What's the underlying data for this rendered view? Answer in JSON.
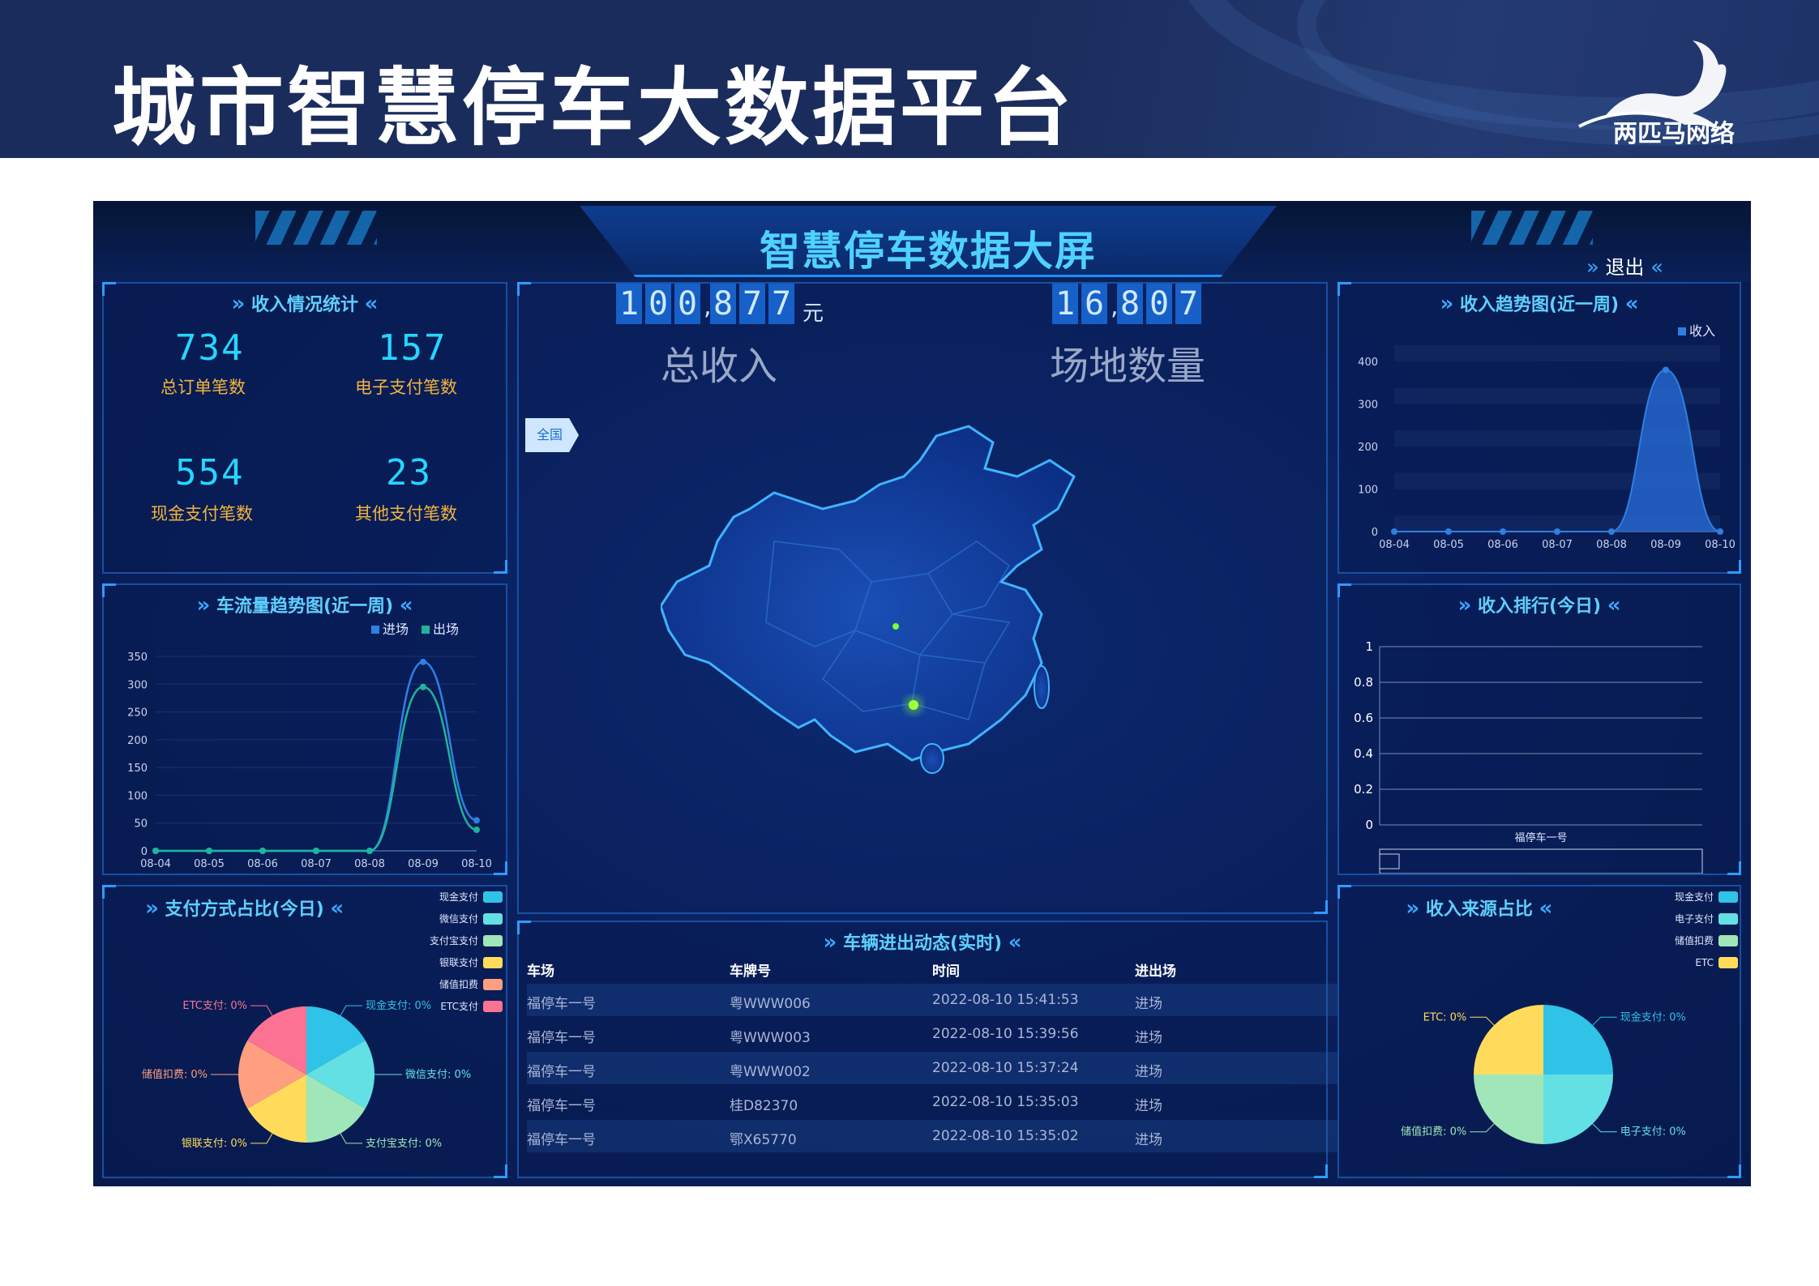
{
  "slide": {
    "title": "城市智慧停车大数据平台",
    "logo_text": "两匹马网络"
  },
  "screen": {
    "title": "智慧停车数据大屏",
    "exit_label": "退出"
  },
  "income_stats": {
    "title": "收入情况统计",
    "items": [
      {
        "value": "734",
        "label": "总订单笔数"
      },
      {
        "value": "157",
        "label": "电子支付笔数"
      },
      {
        "value": "554",
        "label": "现金支付笔数"
      },
      {
        "value": "23",
        "label": "其他支付笔数"
      }
    ]
  },
  "center": {
    "total_income_digits": [
      "1",
      "0",
      "0",
      ",",
      "8",
      "7",
      "7"
    ],
    "total_income_unit": "元",
    "total_income_label": "总收入",
    "venue_digits": [
      "1",
      "6",
      ",",
      "8",
      "0",
      "7"
    ],
    "venue_label": "场地数量",
    "map_button": "全国"
  },
  "traffic_trend": {
    "title": "车流量趋势图(近一周)",
    "chart_data": {
      "type": "line",
      "x": [
        "08-04",
        "08-05",
        "08-06",
        "08-07",
        "08-08",
        "08-09",
        "08-10"
      ],
      "series": [
        {
          "name": "进场",
          "values": [
            0,
            0,
            0,
            0,
            0,
            340,
            55
          ]
        },
        {
          "name": "出场",
          "values": [
            0,
            0,
            0,
            0,
            0,
            295,
            38
          ]
        }
      ],
      "yticks": [
        0,
        50,
        100,
        150,
        200,
        250,
        300,
        350
      ],
      "ylim": [
        0,
        350
      ]
    }
  },
  "payment_share": {
    "title": "支付方式占比(今日)",
    "legend": [
      "现金支付",
      "微信支付",
      "支付宝支付",
      "银联支付",
      "储值扣费",
      "ETC支付"
    ],
    "labels": [
      "现金支付: 0%",
      "微信支付: 0%",
      "支付宝支付: 0%",
      "银联支付: 0%",
      "储值扣费: 0%",
      "ETC支付: 0%"
    ],
    "chart_data": {
      "type": "pie",
      "categories": [
        "现金支付",
        "微信支付",
        "支付宝支付",
        "银联支付",
        "储值扣费",
        "ETC支付"
      ],
      "values": [
        1,
        1,
        1,
        1,
        1,
        1
      ],
      "colors": [
        "#2fc3e8",
        "#63e0e4",
        "#9fe6b8",
        "#ffdb5c",
        "#ff9f7f",
        "#fb7293"
      ]
    }
  },
  "income_trend": {
    "title": "收入趋势图(近一周)",
    "chart_data": {
      "type": "area",
      "x": [
        "08-04",
        "08-05",
        "08-06",
        "08-07",
        "08-08",
        "08-09",
        "08-10"
      ],
      "series": [
        {
          "name": "收入",
          "values": [
            0,
            0,
            0,
            0,
            0,
            380,
            0
          ]
        }
      ],
      "yticks": [
        0,
        100,
        200,
        300,
        400
      ],
      "ylim": [
        0,
        400
      ]
    }
  },
  "income_rank": {
    "title": "收入排行(今日)",
    "chart_data": {
      "type": "bar",
      "categories": [
        "福停车一号"
      ],
      "values": [
        0
      ],
      "yticks": [
        "0",
        "0.2",
        "0.4",
        "0.6",
        "0.8",
        "1"
      ],
      "ylim": [
        0,
        1
      ]
    }
  },
  "income_source": {
    "title": "收入来源占比",
    "legend": [
      "现金支付",
      "电子支付",
      "储值扣费",
      "ETC"
    ],
    "labels": [
      "现金支付: 0%",
      "电子支付: 0%",
      "储值扣费: 0%",
      "ETC: 0%"
    ],
    "chart_data": {
      "type": "pie",
      "categories": [
        "现金支付",
        "电子支付",
        "储值扣费",
        "ETC"
      ],
      "values": [
        1,
        1,
        1,
        1
      ],
      "colors": [
        "#2fc3e8",
        "#63e0e4",
        "#9fe6b8",
        "#ffdb5c"
      ]
    }
  },
  "vehicle_log": {
    "title": "车辆进出动态(实时)",
    "headers": [
      "车场",
      "车牌号",
      "时间",
      "进出场"
    ],
    "rows": [
      [
        "福停车一号",
        "粤WWW006",
        "2022-08-10 15:41:53",
        "进场"
      ],
      [
        "福停车一号",
        "粤WWW003",
        "2022-08-10 15:39:56",
        "进场"
      ],
      [
        "福停车一号",
        "粤WWW002",
        "2022-08-10 15:37:24",
        "进场"
      ],
      [
        "福停车一号",
        "桂D82370",
        "2022-08-10 15:35:03",
        "进场"
      ],
      [
        "福停车一号",
        "鄂X65770",
        "2022-08-10 15:35:02",
        "进场"
      ]
    ]
  },
  "colors": {
    "accent": "#26d6ff",
    "label_gold": "#f3b33d",
    "series_in": "#2f7fe0",
    "series_out": "#1fb59a"
  }
}
